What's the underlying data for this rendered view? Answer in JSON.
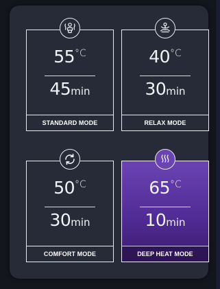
{
  "modes": [
    {
      "temperature": "55",
      "temp_unit": "°C",
      "duration": "45",
      "duration_unit": "min",
      "label": "STANDARD MODE",
      "icon": "person-heat-icon",
      "selected": false
    },
    {
      "temperature": "40",
      "temp_unit": "°C",
      "duration": "30",
      "duration_unit": "min",
      "label": "RELAX MODE",
      "icon": "meditation-icon",
      "selected": false
    },
    {
      "temperature": "50",
      "temp_unit": "°C",
      "duration": "30",
      "duration_unit": "min",
      "label": "COMFORT MODE",
      "icon": "refresh-circle-icon",
      "selected": false
    },
    {
      "temperature": "65",
      "temp_unit": "°C",
      "duration": "10",
      "duration_unit": "min",
      "label": "DEEP HEAT MODE",
      "icon": "heat-waves-icon",
      "selected": true
    }
  ],
  "colors": {
    "background": "#14161e",
    "panel": "#272b38",
    "selected_accent": "#6a44b3",
    "text": "#f2f3f6"
  }
}
